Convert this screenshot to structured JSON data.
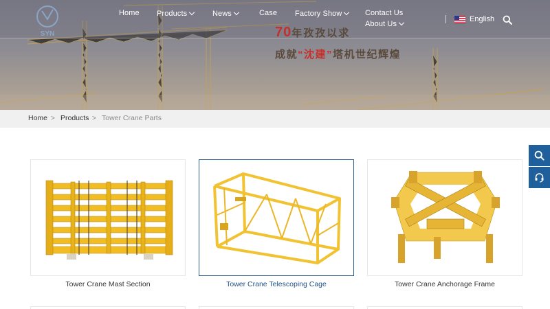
{
  "nav": {
    "items": [
      {
        "label": "Home",
        "dropdown": false
      },
      {
        "label": "Products",
        "dropdown": true
      },
      {
        "label": "News",
        "dropdown": true
      },
      {
        "label": "Case",
        "dropdown": false
      },
      {
        "label": "Factory Show",
        "dropdown": true
      },
      {
        "label": "Contact Us",
        "dropdown": false
      },
      {
        "label": "About Us",
        "dropdown": true
      }
    ],
    "language": "English",
    "logo_text": "SYN"
  },
  "hero": {
    "slogan_number": "70",
    "slogan_line1_rest": "年孜孜以求",
    "slogan_line2_a": "成就",
    "slogan_line2_quoted": "“沈建”",
    "slogan_line2_b": "塔机世纪辉煌"
  },
  "breadcrumb": {
    "items": [
      "Home",
      "Products",
      "Tower Crane Parts"
    ],
    "separator": ">"
  },
  "products": [
    {
      "title": "Tower Crane Mast Section",
      "active": false
    },
    {
      "title": "Tower Crane Telescoping Cage",
      "active": true
    },
    {
      "title": "Tower Crane Anchorage Frame",
      "active": false
    }
  ],
  "colors": {
    "brand_blue": "#1f5f9c",
    "active_title": "#1f4f86",
    "crane_yellow": "#f1c232",
    "slogan_red": "#c4302b"
  },
  "side_toolbar": [
    "search-icon",
    "headset-icon"
  ]
}
